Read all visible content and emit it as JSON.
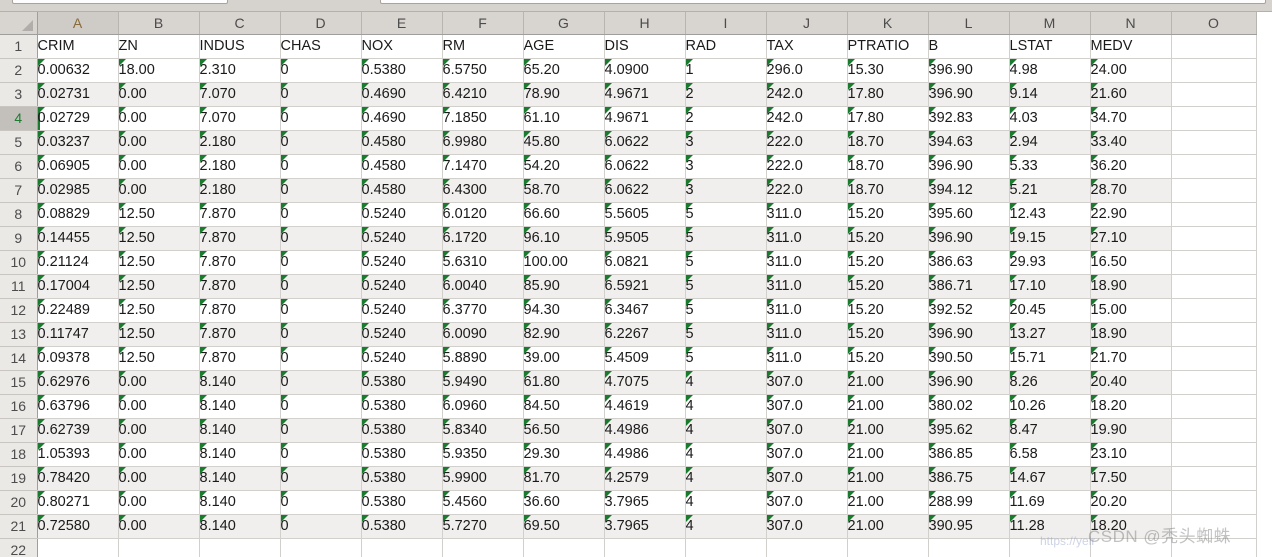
{
  "app": {
    "type": "spreadsheet",
    "selected_cell": "A4",
    "selected_row": 4,
    "selected_column": "A"
  },
  "grid": {
    "column_letters": [
      "A",
      "B",
      "C",
      "D",
      "E",
      "F",
      "G",
      "H",
      "I",
      "J",
      "K",
      "L",
      "M",
      "N",
      "O"
    ],
    "row_numbers": [
      1,
      2,
      3,
      4,
      5,
      6,
      7,
      8,
      9,
      10,
      11,
      12,
      13,
      14,
      15,
      16,
      17,
      18,
      19,
      20,
      21,
      22
    ],
    "corner_label": "select-all"
  },
  "sheet": {
    "headers": [
      "CRIM",
      "ZN",
      "INDUS",
      "CHAS",
      "NOX",
      "RM",
      "AGE",
      "DIS",
      "RAD",
      "TAX",
      "PTRATIO",
      "B",
      "LSTAT",
      "MEDV"
    ],
    "rows": [
      [
        "0.00632",
        "18.00",
        "2.310",
        "0",
        "0.5380",
        "6.5750",
        "65.20",
        "4.0900",
        "1",
        "296.0",
        "15.30",
        "396.90",
        "4.98",
        "24.00"
      ],
      [
        "0.02731",
        "0.00",
        "7.070",
        "0",
        "0.4690",
        "6.4210",
        "78.90",
        "4.9671",
        "2",
        "242.0",
        "17.80",
        "396.90",
        "9.14",
        "21.60"
      ],
      [
        "0.02729",
        "0.00",
        "7.070",
        "0",
        "0.4690",
        "7.1850",
        "61.10",
        "4.9671",
        "2",
        "242.0",
        "17.80",
        "392.83",
        "4.03",
        "34.70"
      ],
      [
        "0.03237",
        "0.00",
        "2.180",
        "0",
        "0.4580",
        "6.9980",
        "45.80",
        "6.0622",
        "3",
        "222.0",
        "18.70",
        "394.63",
        "2.94",
        "33.40"
      ],
      [
        "0.06905",
        "0.00",
        "2.180",
        "0",
        "0.4580",
        "7.1470",
        "54.20",
        "6.0622",
        "3",
        "222.0",
        "18.70",
        "396.90",
        "5.33",
        "36.20"
      ],
      [
        "0.02985",
        "0.00",
        "2.180",
        "0",
        "0.4580",
        "6.4300",
        "58.70",
        "6.0622",
        "3",
        "222.0",
        "18.70",
        "394.12",
        "5.21",
        "28.70"
      ],
      [
        "0.08829",
        "12.50",
        "7.870",
        "0",
        "0.5240",
        "6.0120",
        "66.60",
        "5.5605",
        "5",
        "311.0",
        "15.20",
        "395.60",
        "12.43",
        "22.90"
      ],
      [
        "0.14455",
        "12.50",
        "7.870",
        "0",
        "0.5240",
        "6.1720",
        "96.10",
        "5.9505",
        "5",
        "311.0",
        "15.20",
        "396.90",
        "19.15",
        "27.10"
      ],
      [
        "0.21124",
        "12.50",
        "7.870",
        "0",
        "0.5240",
        "5.6310",
        "100.00",
        "6.0821",
        "5",
        "311.0",
        "15.20",
        "386.63",
        "29.93",
        "16.50"
      ],
      [
        "0.17004",
        "12.50",
        "7.870",
        "0",
        "0.5240",
        "6.0040",
        "85.90",
        "6.5921",
        "5",
        "311.0",
        "15.20",
        "386.71",
        "17.10",
        "18.90"
      ],
      [
        "0.22489",
        "12.50",
        "7.870",
        "0",
        "0.5240",
        "6.3770",
        "94.30",
        "6.3467",
        "5",
        "311.0",
        "15.20",
        "392.52",
        "20.45",
        "15.00"
      ],
      [
        "0.11747",
        "12.50",
        "7.870",
        "0",
        "0.5240",
        "6.0090",
        "82.90",
        "6.2267",
        "5",
        "311.0",
        "15.20",
        "396.90",
        "13.27",
        "18.90"
      ],
      [
        "0.09378",
        "12.50",
        "7.870",
        "0",
        "0.5240",
        "5.8890",
        "39.00",
        "5.4509",
        "5",
        "311.0",
        "15.20",
        "390.50",
        "15.71",
        "21.70"
      ],
      [
        "0.62976",
        "0.00",
        "8.140",
        "0",
        "0.5380",
        "5.9490",
        "61.80",
        "4.7075",
        "4",
        "307.0",
        "21.00",
        "396.90",
        "8.26",
        "20.40"
      ],
      [
        "0.63796",
        "0.00",
        "8.140",
        "0",
        "0.5380",
        "6.0960",
        "84.50",
        "4.4619",
        "4",
        "307.0",
        "21.00",
        "380.02",
        "10.26",
        "18.20"
      ],
      [
        "0.62739",
        "0.00",
        "8.140",
        "0",
        "0.5380",
        "5.8340",
        "56.50",
        "4.4986",
        "4",
        "307.0",
        "21.00",
        "395.62",
        "8.47",
        "19.90"
      ],
      [
        "1.05393",
        "0.00",
        "8.140",
        "0",
        "0.5380",
        "5.9350",
        "29.30",
        "4.4986",
        "4",
        "307.0",
        "21.00",
        "386.85",
        "6.58",
        "23.10"
      ],
      [
        "0.78420",
        "0.00",
        "8.140",
        "0",
        "0.5380",
        "5.9900",
        "81.70",
        "4.2579",
        "4",
        "307.0",
        "21.00",
        "386.75",
        "14.67",
        "17.50"
      ],
      [
        "0.80271",
        "0.00",
        "8.140",
        "0",
        "0.5380",
        "5.4560",
        "36.60",
        "3.7965",
        "4",
        "307.0",
        "21.00",
        "288.99",
        "11.69",
        "20.20"
      ],
      [
        "0.72580",
        "0.00",
        "8.140",
        "0",
        "0.5380",
        "5.7270",
        "69.50",
        "3.7965",
        "4",
        "307.0",
        "21.00",
        "390.95",
        "11.28",
        "18.20"
      ]
    ]
  },
  "watermark": {
    "url": "https://yeir",
    "text": "CSDN @秃头蜘蛛"
  },
  "colors": {
    "header_bg": "#d8d5d1",
    "alt_row_bg": "#f0efed",
    "selection_green": "#1d7a33",
    "flag_green": "#1a7a2e",
    "grid_line": "#d2d0cd"
  }
}
